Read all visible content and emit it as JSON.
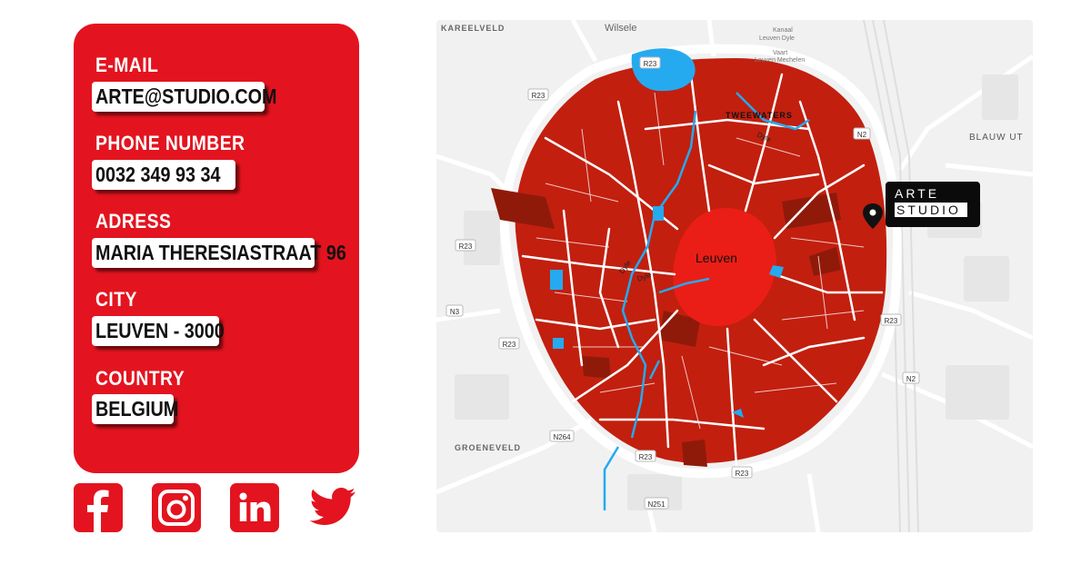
{
  "contact": {
    "email": {
      "label": "E-MAIL",
      "value": "ARTE@STUDIO.COM"
    },
    "phone": {
      "label": "PHONE NUMBER",
      "value": "0032 349 93 34"
    },
    "address": {
      "label": "ADRESS",
      "value": "MARIA THERESIASTRAAT 96"
    },
    "city": {
      "label": "CITY",
      "value": "LEUVEN - 3000"
    },
    "country": {
      "label": "COUNTRY",
      "value": "BELGIUM"
    }
  },
  "socials": [
    {
      "icon": "facebook-icon"
    },
    {
      "icon": "instagram-icon"
    },
    {
      "icon": "linkedin-icon"
    },
    {
      "icon": "twitter-icon"
    }
  ],
  "map": {
    "city_label": "Leuven",
    "districts": {
      "nw": "KAREELVELD",
      "top": "Wilsele",
      "ne": "BLAUW UT",
      "sw": "GROENEVELD",
      "north_area": "TWEEWATERS"
    },
    "top_right_lines": [
      "Kanaal",
      "Leuven Dyle",
      "Vaart",
      "Leuven Mechelen"
    ],
    "roads": [
      "R23",
      "R23",
      "R23",
      "R23",
      "R23",
      "R23",
      "R23",
      "N2",
      "N2",
      "N3",
      "N264",
      "N251"
    ],
    "rivers": [
      "Dyle",
      "Dyle",
      "Dyle"
    ],
    "marker": {
      "line1": "ARTE",
      "line2": "STUDIO"
    }
  },
  "colors": {
    "brand_red": "#e3141f",
    "map_red": "#c21f0f",
    "water": "#25aaf0"
  }
}
